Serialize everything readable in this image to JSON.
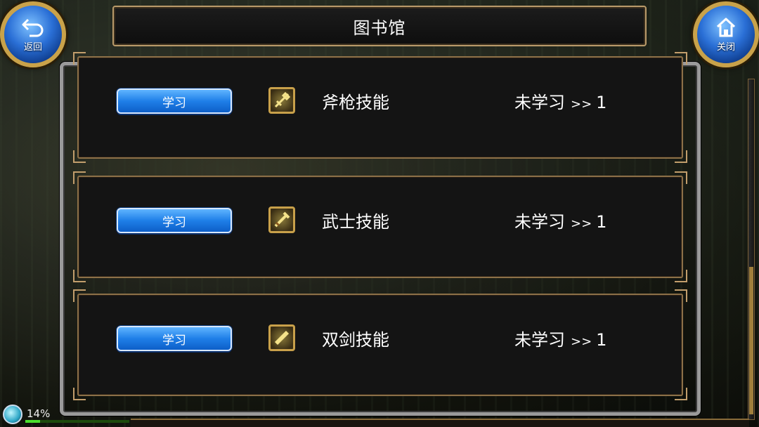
{
  "header": {
    "title": "图书馆",
    "back_label": "返回",
    "close_label": "关闭"
  },
  "skills": [
    {
      "button_label": "学习",
      "name": "斧枪技能",
      "status": "未学习",
      "arrow": ">>",
      "level": "1",
      "icon": "axe-spear-skill-icon"
    },
    {
      "button_label": "学习",
      "name": "武士技能",
      "status": "未学习",
      "arrow": ">>",
      "level": "1",
      "icon": "samurai-skill-icon"
    },
    {
      "button_label": "学习",
      "name": "双剑技能",
      "status": "未学习",
      "arrow": ">>",
      "level": "1",
      "icon": "dual-sword-skill-icon"
    }
  ],
  "status": {
    "percent": "14%",
    "progress_fraction": 0.14
  },
  "colors": {
    "button_blue": "#1f7fe8",
    "frame_gold": "#c9a24a",
    "row_border": "#8c7048"
  }
}
